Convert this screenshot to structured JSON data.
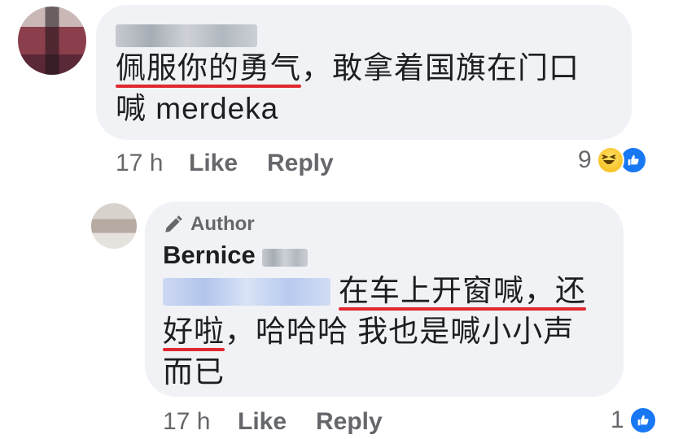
{
  "main_comment": {
    "text_underlined": "佩服你的勇气",
    "text_rest_line1": "，敢拿着国旗在门口",
    "text_line2": "喊 merdeka",
    "time": "17 h",
    "like_label": "Like",
    "reply_label": "Reply",
    "reaction_count": "9",
    "reaction_icons": [
      "haha-icon",
      "like-icon"
    ]
  },
  "reply_comment": {
    "author_badge": "Author",
    "author_name": "Bernice",
    "line1_underlined": "在车上开窗喊，还",
    "line2_underlined": "好啦",
    "line2_rest": "，哈哈哈 我也是喊小小声",
    "line3": "而已",
    "time": "17 h",
    "like_label": "Like",
    "reply_label": "Reply",
    "reaction_count": "1",
    "reaction_icons": [
      "like-icon"
    ]
  },
  "colors": {
    "bubble": "#f0f2f5",
    "underline": "#e0282e",
    "meta": "#65676b",
    "like_blue": "#1877f2"
  }
}
